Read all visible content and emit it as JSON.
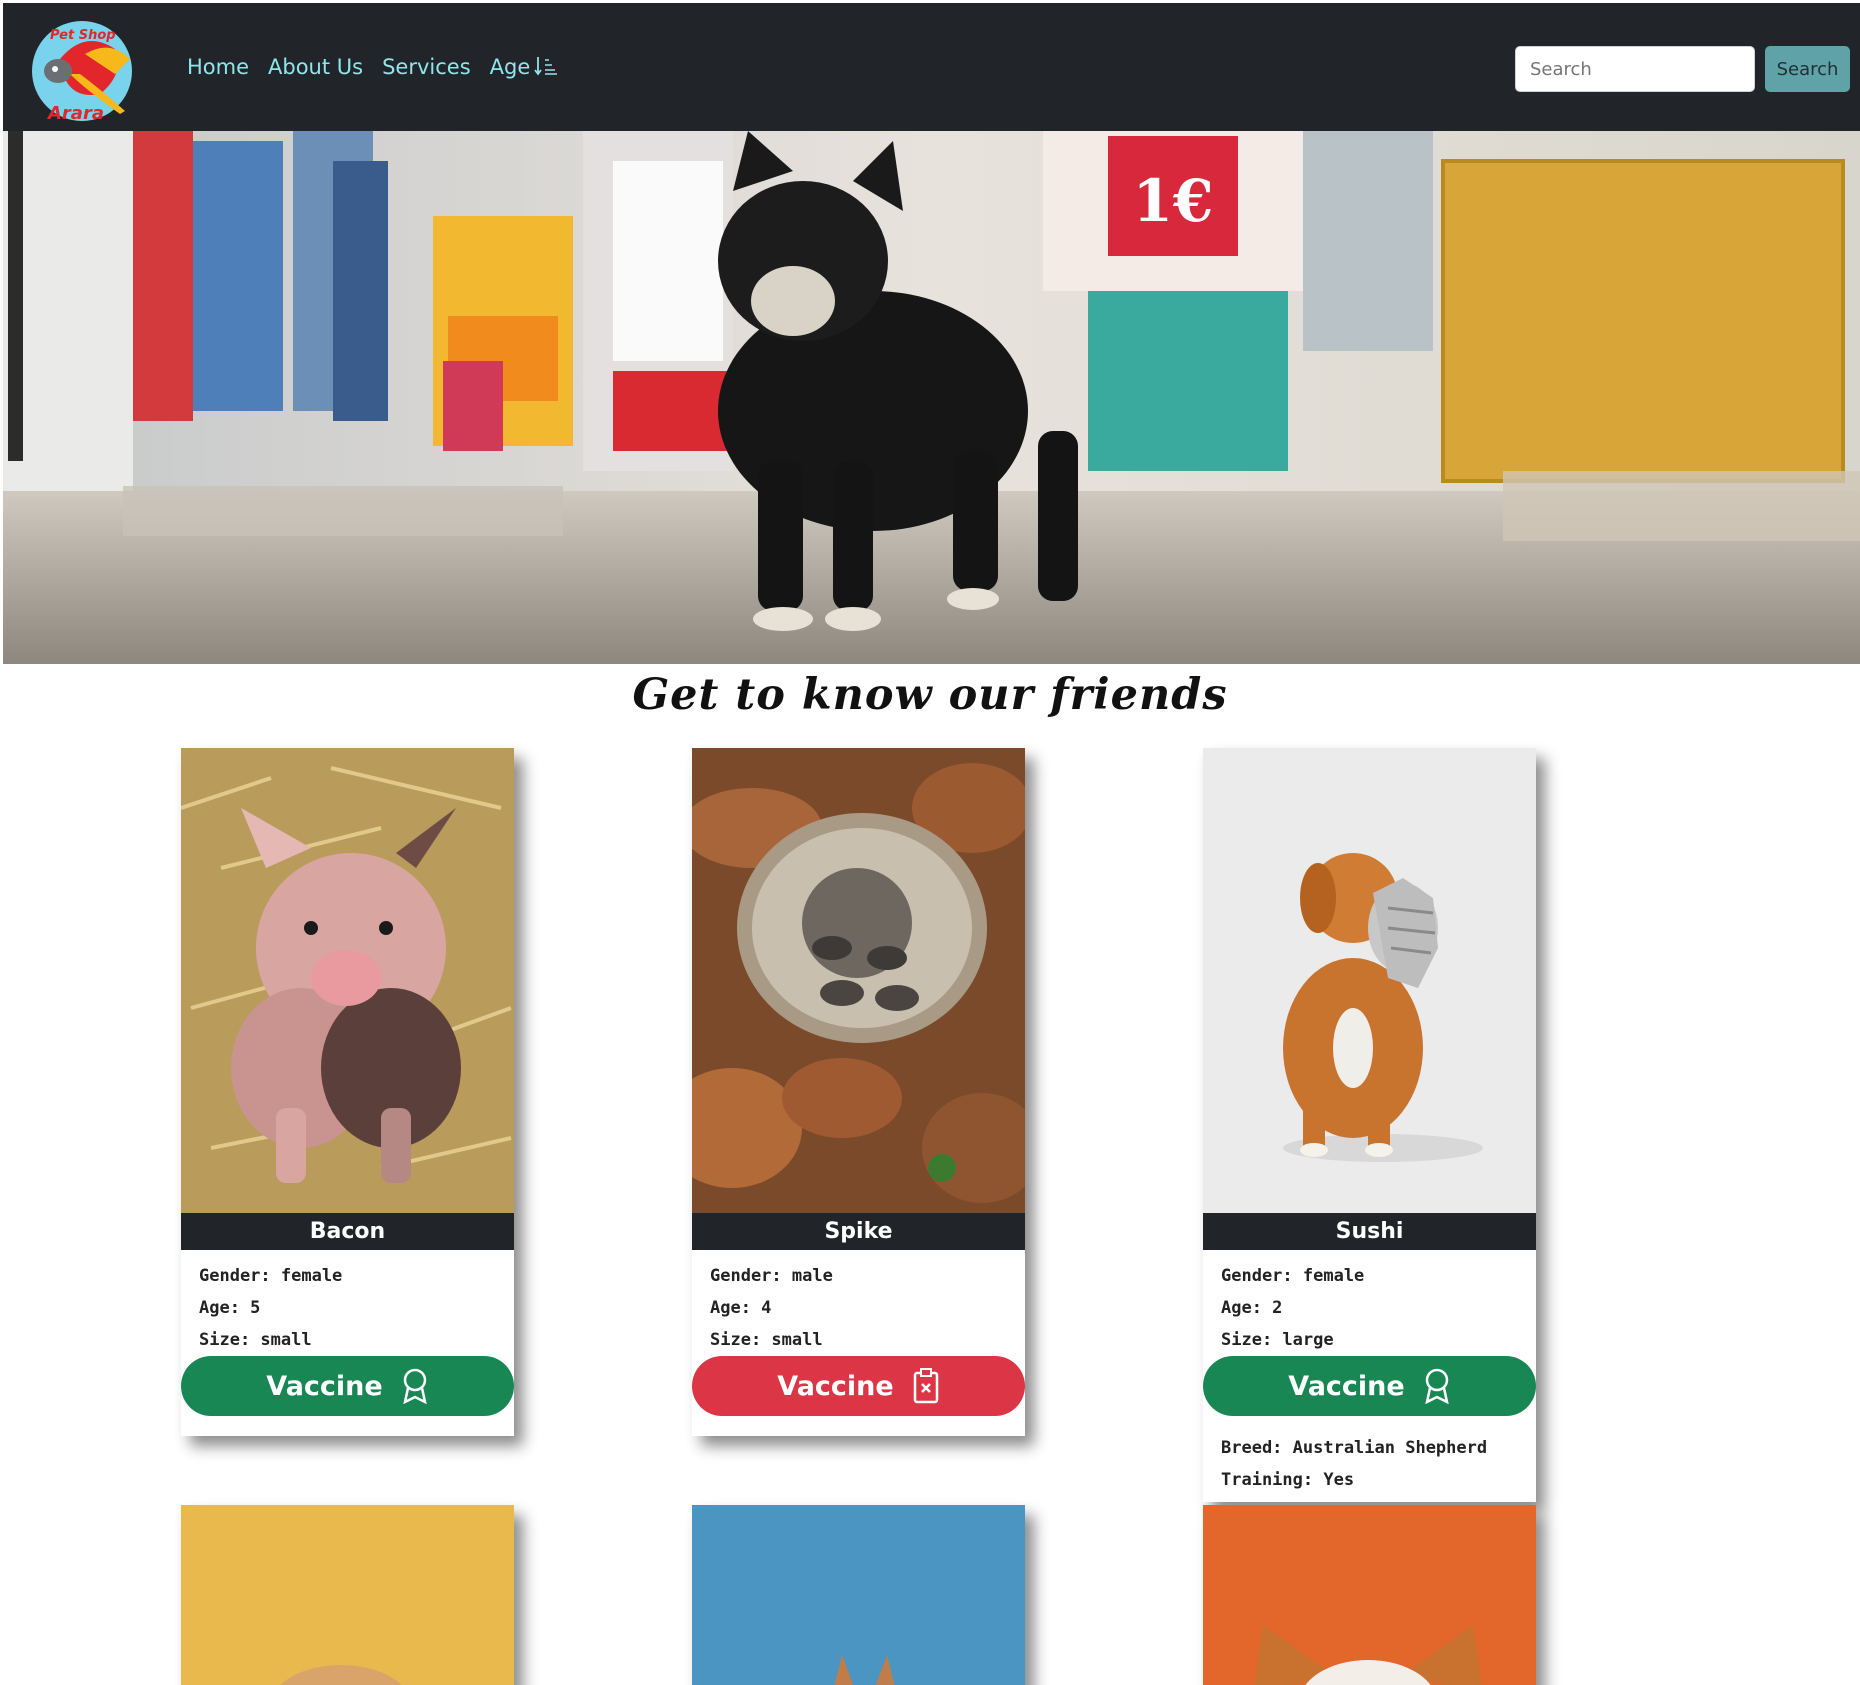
{
  "nav": {
    "logo_alt": "Pet Shop Arara",
    "logo_text_top": "Pet Shop",
    "logo_text_bottom": "Arara",
    "links": [
      "Home",
      "About Us",
      "Services",
      "Age"
    ],
    "search_placeholder": "Search",
    "search_button": "Search"
  },
  "hero": {
    "price_sign": "1€"
  },
  "heading": "Get to know our friends",
  "cards": [
    {
      "name": "Bacon",
      "gender": "Gender: female",
      "age": "Age: 5",
      "size": "Size: small",
      "vaccine": "Vaccine",
      "vaccinated": true
    },
    {
      "name": "Spike",
      "gender": "Gender: male",
      "age": "Age: 4",
      "size": "Size: small",
      "vaccine": "Vaccine",
      "vaccinated": false
    },
    {
      "name": "Sushi",
      "gender": "Gender: female",
      "age": "Age: 2",
      "size": "Size: large",
      "vaccine": "Vaccine",
      "vaccinated": true,
      "breed": "Breed: Australian Shepherd",
      "training": "Training: Yes"
    }
  ],
  "colors": {
    "navbar": "#212529",
    "nav_link": "#8fe6ea",
    "vaccinated": "#198754",
    "not_vaccinated": "#dc3545",
    "search_button": "#5fa3a8"
  }
}
